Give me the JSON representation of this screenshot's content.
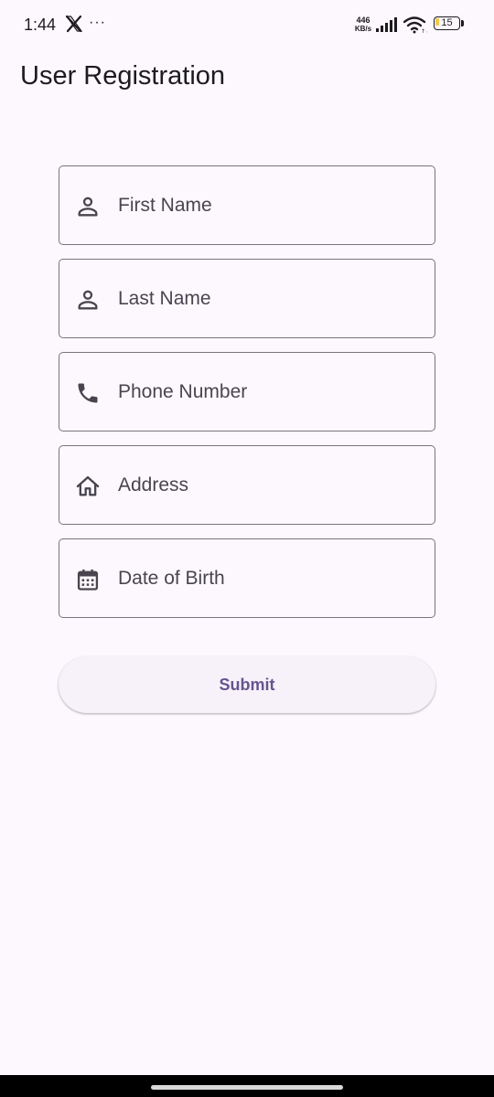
{
  "status_bar": {
    "time": "1:44",
    "more": "···",
    "net_speed_value": "446",
    "net_speed_unit": "KB/s",
    "battery_level": "15",
    "icons": [
      "x-app-icon",
      "more-icon",
      "signal-icon",
      "wifi-icon",
      "battery-icon"
    ]
  },
  "page": {
    "title": "User Registration"
  },
  "form": {
    "fields": [
      {
        "placeholder": "First Name",
        "value": "",
        "icon": "person-icon"
      },
      {
        "placeholder": "Last Name",
        "value": "",
        "icon": "person-icon"
      },
      {
        "placeholder": "Phone Number",
        "value": "",
        "icon": "phone-icon"
      },
      {
        "placeholder": "Address",
        "value": "",
        "icon": "home-icon"
      },
      {
        "placeholder": "Date of Birth",
        "value": "",
        "icon": "calendar-icon"
      }
    ],
    "submit_label": "Submit"
  },
  "colors": {
    "background": "#fdf8fd",
    "outline": "#79747e",
    "primary": "#65558f",
    "on_surface": "#1d1b20",
    "button_surface": "#f7f2fa"
  }
}
